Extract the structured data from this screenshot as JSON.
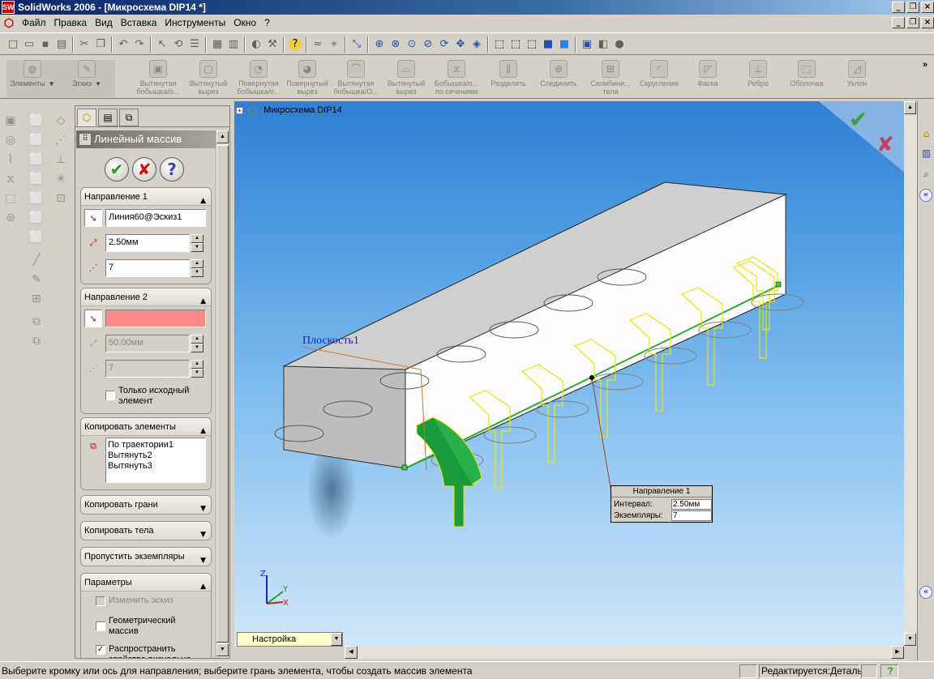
{
  "window": {
    "title": "SolidWorks 2006 - [Микросхема DIP14 *]"
  },
  "menu": {
    "items": [
      "Файл",
      "Правка",
      "Вид",
      "Вставка",
      "Инструменты",
      "Окно",
      "?"
    ]
  },
  "commandmanager": {
    "tools": [
      {
        "label": "Элементы",
        "icon": "features-icon"
      },
      {
        "label": "Эскиз",
        "icon": "sketch-icon"
      },
      {
        "label": "Вытянутая бобышка/о...",
        "icon": "extrude-boss-icon"
      },
      {
        "label": "Вытянутый вырез",
        "icon": "extrude-cut-icon"
      },
      {
        "label": "Повернутая бобышка/о...",
        "icon": "revolve-boss-icon"
      },
      {
        "label": "Повернутый вырез",
        "icon": "revolve-cut-icon"
      },
      {
        "label": "Вытянутая бобышка/О...",
        "icon": "swept-boss-icon"
      },
      {
        "label": "Вытянутый вырез",
        "icon": "swept-cut-icon"
      },
      {
        "label": "Бобышка/о... по сечениям",
        "icon": "loft-icon"
      },
      {
        "label": "Разделить",
        "icon": "split-icon"
      },
      {
        "label": "Соединить",
        "icon": "combine-icon"
      },
      {
        "label": "Скомбини... тела",
        "icon": "combine-bodies-icon"
      },
      {
        "label": "Скругление",
        "icon": "fillet-icon"
      },
      {
        "label": "Фаска",
        "icon": "chamfer-icon"
      },
      {
        "label": "Ребро",
        "icon": "rib-icon"
      },
      {
        "label": "Оболочка",
        "icon": "shell-icon"
      },
      {
        "label": "Уклон",
        "icon": "draft-icon"
      }
    ]
  },
  "propertymanager": {
    "title": "Линейный массив",
    "direction1": {
      "header": "Направление 1",
      "edge": "Линия60@Эскиз1",
      "spacing": "2.50мм",
      "instances": "7"
    },
    "direction2": {
      "header": "Направление 2",
      "edge": "",
      "spacing": "50.00мм",
      "instances": "7",
      "seed_only_label": "Только исходный элемент"
    },
    "features_to_pattern": {
      "header": "Копировать элементы",
      "items": [
        "По траектории1",
        "Вытянуть2",
        "Вытянуть3"
      ]
    },
    "faces_header": "Копировать грани",
    "bodies_header": "Копировать тела",
    "skip_header": "Пропустить экземпляры",
    "options": {
      "header": "Параметры",
      "vary_sketch": "Изменить эскиз",
      "geometry_pattern": "Геометрический массив",
      "propagate": "Распространить свойства визуально"
    }
  },
  "graphics": {
    "tree_label": "Микросхема DIP14",
    "plane_label": "Плоскость1",
    "callout": {
      "title": "Направление 1",
      "interval_label": "Интервал:",
      "interval_value": "2.50мм",
      "instances_label": "Экземпляры:",
      "instances_value": "7"
    },
    "axis_labels": {
      "z": "Z",
      "y": "Y",
      "x": "X"
    }
  },
  "configuration": {
    "selected": "Настройка"
  },
  "status": {
    "message": "Выберите кромку или ось для направления; выберите грань элемента, чтобы создать массив элемента",
    "mode": "Редактируется:Деталь"
  },
  "colors": {
    "accent_ok": "#2c9a1c",
    "accent_cancel": "#d01010",
    "selection_green": "#1a9a3a",
    "preview_yellow": "#ffff00",
    "pink_field": "#ff8a8a"
  }
}
